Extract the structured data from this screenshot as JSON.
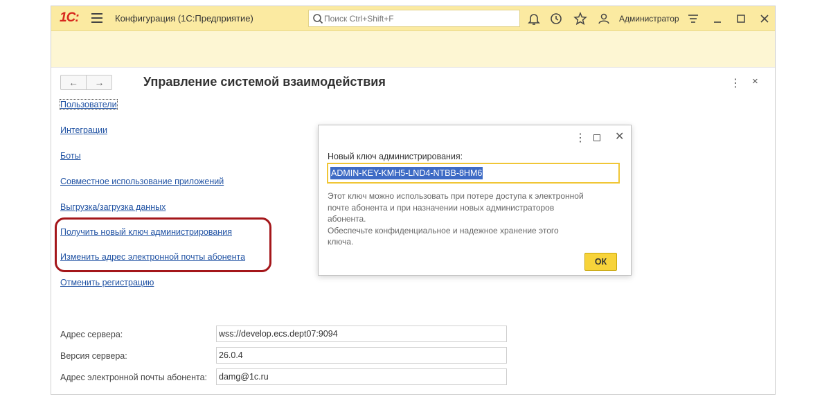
{
  "titlebar": {
    "logo": "1С:",
    "app_title": "Конфигурация  (1С:Предприятие)",
    "search_placeholder": "Поиск Ctrl+Shift+F",
    "user": "Администратор"
  },
  "form": {
    "title": "Управление системой взаимодействия",
    "nav": {
      "back": "←",
      "forward": "→"
    },
    "links": [
      "Пользователи",
      "Интеграции",
      "Боты",
      "Совместное использование приложений",
      "Выгрузка/загрузка данных",
      "Получить новый ключ администрирования",
      "Изменить адрес электронной почты абонента",
      "Отменить регистрацию"
    ],
    "fields": [
      {
        "label": "Адрес сервера:",
        "value": "wss://develop.ecs.dept07:9094"
      },
      {
        "label": "Версия сервера:",
        "value": "26.0.4"
      },
      {
        "label": "Адрес электронной почты абонента:",
        "value": "damg@1c.ru"
      }
    ]
  },
  "dialog": {
    "label": "Новый ключ администрирования:",
    "key": "ADMIN-KEY-KMH5-LND4-NTBB-8HM6",
    "description_lines": [
      "Этот ключ можно использовать при потере доступа к электронной",
      "почте абонента и при назначении новых администраторов",
      "абонента.",
      "Обеспечьте конфиденциальное и надежное хранение этого",
      "ключа."
    ],
    "ok_label": "ОК"
  },
  "colors": {
    "titlebar_bg": "#fbeaa1",
    "link": "#2052a3",
    "accent": "#f7d33a",
    "highlight_border": "#a4161a",
    "selection": "#3e6bc5"
  }
}
